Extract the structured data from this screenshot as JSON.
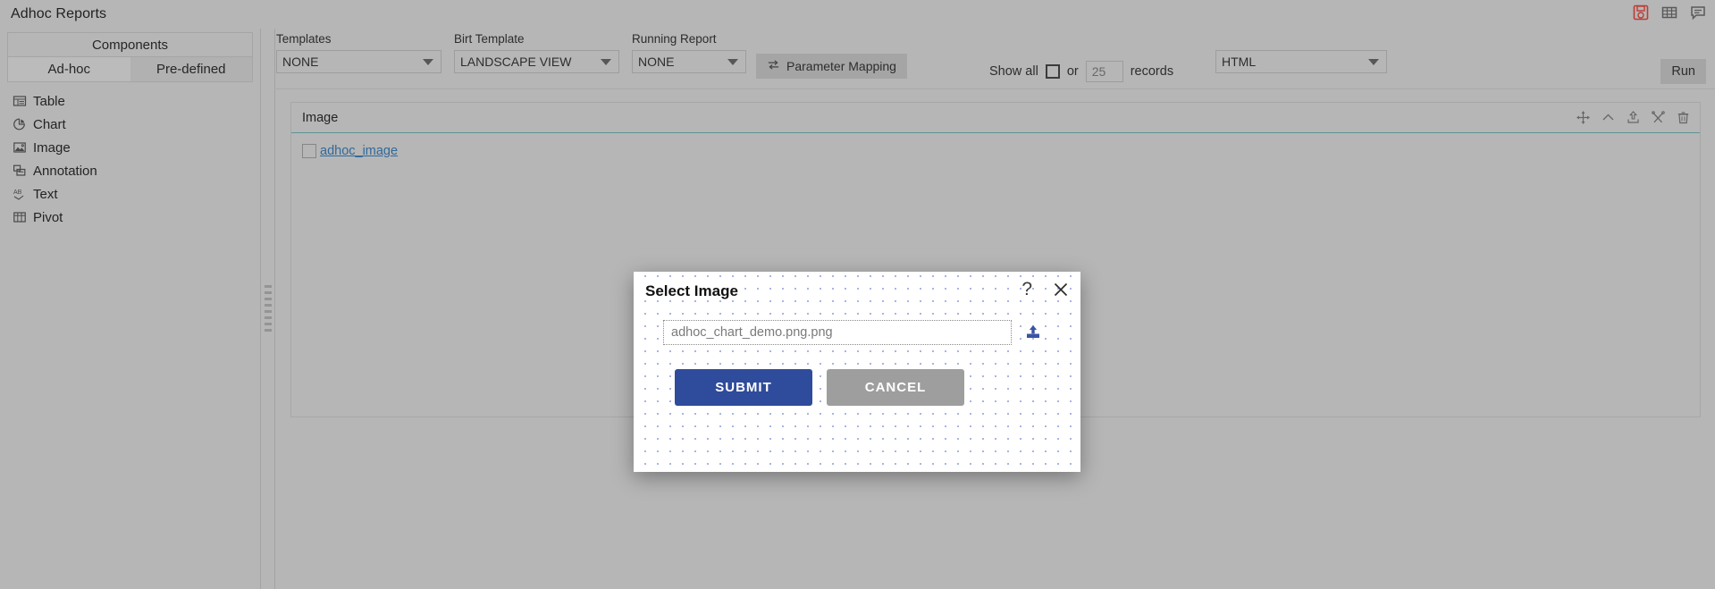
{
  "app": {
    "title": "Adhoc Reports",
    "window_icons": [
      {
        "name": "save-icon",
        "label": "Save"
      },
      {
        "name": "table-grid-icon",
        "label": "Grid"
      },
      {
        "name": "comment-icon",
        "label": "Comments"
      }
    ]
  },
  "sidebar": {
    "header": "Components",
    "tabs": [
      {
        "label": "Ad-hoc",
        "active": true
      },
      {
        "label": "Pre-defined",
        "active": false
      }
    ],
    "items": [
      {
        "label": "Table",
        "icon": "table-icon"
      },
      {
        "label": "Chart",
        "icon": "pie-chart-icon"
      },
      {
        "label": "Image",
        "icon": "image-icon"
      },
      {
        "label": "Annotation",
        "icon": "annotation-icon"
      },
      {
        "label": "Text",
        "icon": "text-ab-icon"
      },
      {
        "label": "Pivot",
        "icon": "pivot-icon"
      }
    ]
  },
  "toolbar": {
    "templates": {
      "label": "Templates",
      "value": "NONE"
    },
    "birt_template": {
      "label": "Birt Template",
      "value": "LANDSCAPE VIEW"
    },
    "running_report": {
      "label": "Running Report",
      "value": "NONE"
    },
    "parameter_mapping_button": "Parameter Mapping",
    "show_all_label": "Show all",
    "or_label": "or",
    "records_value": "25",
    "records_label": "records",
    "format": {
      "value": "HTML"
    },
    "run_button": "Run"
  },
  "panel": {
    "title": "Image",
    "tools": [
      {
        "name": "move-icon"
      },
      {
        "name": "chevron-up-icon"
      },
      {
        "name": "upload-icon"
      },
      {
        "name": "tools-icon"
      },
      {
        "name": "trash-icon"
      }
    ],
    "item_label": "adhoc_image"
  },
  "dialog": {
    "title": "Select Image",
    "help_glyph": "?",
    "file_value": "adhoc_chart_demo.png.png",
    "file_placeholder": "adhoc_chart_demo.png.png",
    "submit_label": "SUBMIT",
    "cancel_label": "CANCEL"
  },
  "colors": {
    "app_background": "#c3c3c3",
    "panel_border": "#b3b3b3",
    "panel_accent": "#5f9ea0",
    "link": "#2f6ea5",
    "submit": "#2f4b9b",
    "cancel": "#9e9e9e",
    "dialog_dot": "#a9b5e2",
    "save_icon": "#cc3b33"
  }
}
